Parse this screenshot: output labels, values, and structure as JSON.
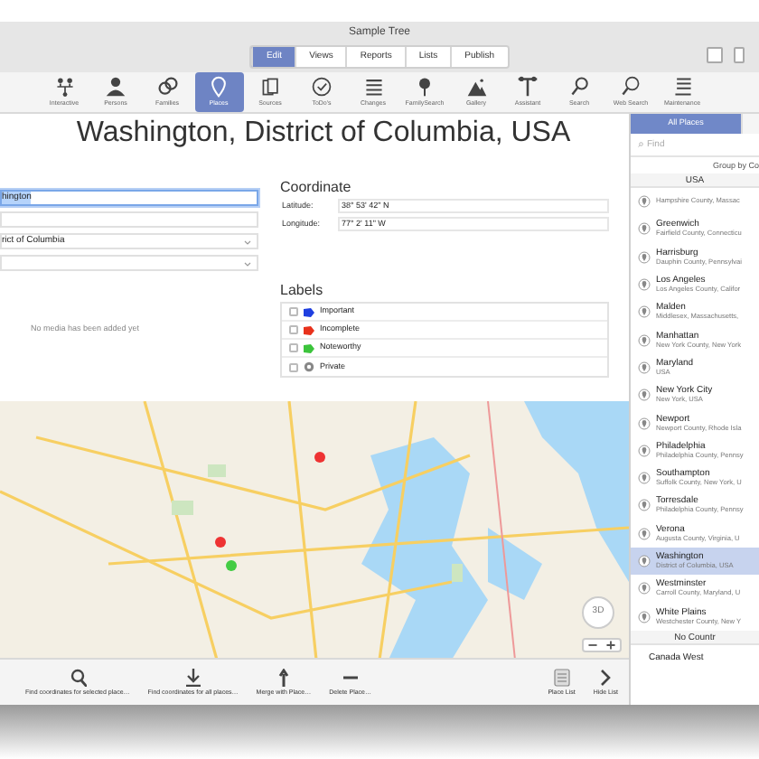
{
  "window": {
    "title": "Sample Tree"
  },
  "modes": [
    {
      "label": "Edit",
      "selected": true
    },
    {
      "label": "Views",
      "selected": false
    },
    {
      "label": "Reports",
      "selected": false
    },
    {
      "label": "Lists",
      "selected": false
    },
    {
      "label": "Publish",
      "selected": false
    }
  ],
  "toolbar": [
    {
      "label": "Interactive",
      "selected": false
    },
    {
      "label": "Persons",
      "selected": false
    },
    {
      "label": "Families",
      "selected": false
    },
    {
      "label": "Places",
      "selected": true
    },
    {
      "label": "Sources",
      "selected": false
    },
    {
      "label": "ToDo's",
      "selected": false
    },
    {
      "label": "Changes",
      "selected": false
    },
    {
      "label": "FamilySearch",
      "selected": false
    },
    {
      "label": "Gallery",
      "selected": false
    },
    {
      "label": "Assistant",
      "selected": false
    },
    {
      "label": "Search",
      "selected": false
    },
    {
      "label": "Web Search",
      "selected": false
    },
    {
      "label": "Maintenance",
      "selected": false
    }
  ],
  "place": {
    "title": "Washington, District of Columbia, USA",
    "fields": [
      {
        "kind": "text",
        "value": "hington",
        "focused": true
      },
      {
        "kind": "text",
        "focused": false
      },
      {
        "kind": "select",
        "value": "rict of Columbia",
        "focused": false
      },
      {
        "kind": "select",
        "focused": false
      }
    ],
    "media_note": "No media has been added yet",
    "coordinate": {
      "heading": "Coordinate",
      "rows": [
        {
          "label": "Latitude:",
          "value": "38° 53' 42\" N"
        },
        {
          "label": "Longitude:",
          "value": "77° 2' 11\" W"
        }
      ]
    },
    "labels": {
      "heading": "Labels",
      "items": [
        {
          "kind": "tag",
          "label": "Important",
          "color": "#1f3fe0",
          "checked": false
        },
        {
          "kind": "tag",
          "label": "Incomplete",
          "color": "#e8321c",
          "checked": false
        },
        {
          "kind": "tag",
          "label": "Noteworthy",
          "color": "#3cc43c",
          "checked": false
        },
        {
          "kind": "private",
          "label": "Private",
          "checked": false
        }
      ]
    },
    "map": {
      "kind": "picture",
      "button_3d": "3D"
    }
  },
  "actions": [
    {
      "kind": "search",
      "label": "Find coordinates for selected place…"
    },
    {
      "kind": "download",
      "label": "Find coordinates for all places…"
    },
    {
      "kind": "merge",
      "label": "Merge with Place…"
    },
    {
      "kind": "minus",
      "label": "Delete Place…"
    }
  ],
  "list_controls": [
    {
      "kind": "list",
      "label": "Place List"
    },
    {
      "kind": "chevron",
      "label": "Hide List"
    }
  ],
  "sidebar": {
    "tab": {
      "label": "All Places",
      "selected": true
    },
    "search": {
      "placeholder": "Find"
    },
    "group_by": "Group by Co",
    "groups": [
      {
        "heading": "USA",
        "items": [
          {
            "detail": "Hampshire County, Massac",
            "selected": false
          },
          {
            "name": "Greenwich",
            "detail": "Fairfield County, Connecticu",
            "selected": false
          },
          {
            "name": "Harrisburg",
            "detail": "Dauphin County, Pennsylvai",
            "selected": false
          },
          {
            "name": "Los Angeles",
            "detail": "Los Angeles County, Califor",
            "selected": false
          },
          {
            "name": "Malden",
            "detail": "Middlesex, Massachusetts,",
            "selected": false
          },
          {
            "name": "Manhattan",
            "detail": "New York County, New York",
            "selected": false
          },
          {
            "name": "Maryland",
            "detail": "USA",
            "selected": false
          },
          {
            "name": "New York City",
            "detail": "New York, USA",
            "selected": false
          },
          {
            "name": "Newport",
            "detail": "Newport County, Rhode Isla",
            "selected": false
          },
          {
            "name": "Philadelphia",
            "detail": "Philadelphia County, Pennsy",
            "selected": false
          },
          {
            "name": "Southampton",
            "detail": "Suffolk County, New York, U",
            "selected": false
          },
          {
            "name": "Torresdale",
            "detail": "Philadelphia County, Pennsy",
            "selected": false
          },
          {
            "name": "Verona",
            "detail": "Augusta County, Virginia, U",
            "selected": false
          },
          {
            "name": "Washington",
            "detail": "District of Columbia, USA",
            "selected": true
          },
          {
            "name": "Westminster",
            "detail": "Carroll County, Maryland, U",
            "selected": false
          },
          {
            "name": "White Plains",
            "detail": "Westchester County, New Y",
            "selected": false
          }
        ]
      },
      {
        "heading": "No Countr",
        "items": [
          {
            "name": "Canada West",
            "selected": false
          }
        ]
      }
    ]
  }
}
